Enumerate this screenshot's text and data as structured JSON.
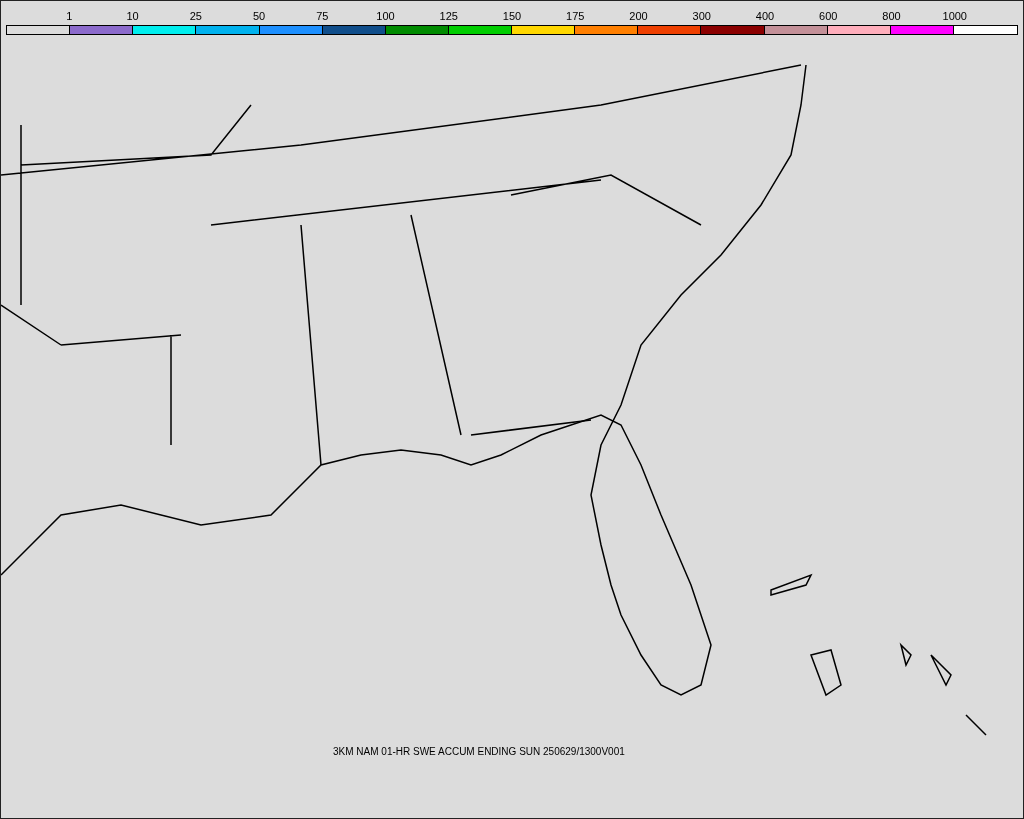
{
  "legend": {
    "labels": [
      "1",
      "10",
      "25",
      "50",
      "75",
      "100",
      "125",
      "150",
      "175",
      "200",
      "300",
      "400",
      "600",
      "800",
      "1000"
    ],
    "swatches": [
      {
        "color": "#dcdcdc"
      },
      {
        "color": "#8c6bcc"
      },
      {
        "color": "#00eeee"
      },
      {
        "color": "#00b2ee"
      },
      {
        "color": "#1e90ff"
      },
      {
        "color": "#104e8b"
      },
      {
        "color": "#008b00"
      },
      {
        "color": "#00cd00"
      },
      {
        "color": "#ffd700"
      },
      {
        "color": "#ff7f00"
      },
      {
        "color": "#ee4000"
      },
      {
        "color": "#8b0000"
      },
      {
        "color": "#c39098"
      },
      {
        "color": "#ffaebc"
      },
      {
        "color": "#ff00ff"
      },
      {
        "color": "#ffffff"
      }
    ]
  },
  "caption": "3KM NAM 01-HR SWE ACCUM ENDING SUN 250629/1300V001"
}
